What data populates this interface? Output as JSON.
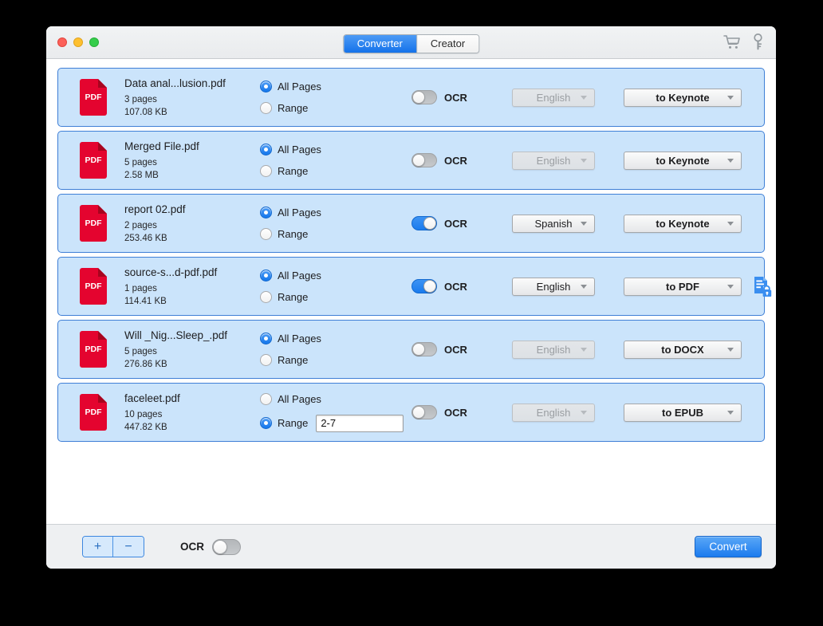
{
  "window": {
    "traffic_lights": [
      "close",
      "minimize",
      "zoom"
    ],
    "tabs": [
      {
        "label": "Converter",
        "active": true
      },
      {
        "label": "Creator",
        "active": false
      }
    ],
    "toolbar_icons": [
      {
        "name": "cart-icon",
        "glyph": "cart"
      },
      {
        "name": "key-icon",
        "glyph": "key"
      }
    ]
  },
  "labels": {
    "all_pages": "All Pages",
    "range": "Range",
    "ocr": "OCR",
    "pdf_badge": "PDF",
    "add": "+",
    "remove": "−"
  },
  "colors": {
    "accent": "#1c7bee",
    "row_background": "#cbe4fb",
    "row_border": "#3f7fd6",
    "pdf_icon": "#e4042f",
    "lock_icon": "#3a8ef0",
    "toolbar_background": "#eef0f2"
  },
  "files": [
    {
      "name": "Data anal...lusion.pdf",
      "pages": "3 pages",
      "size": "107.08 KB",
      "all_pages_selected": true,
      "range_selected": false,
      "range_value": "",
      "ocr_on": false,
      "language": "English",
      "output_format": "to Keynote",
      "locked": false
    },
    {
      "name": "Merged File.pdf",
      "pages": "5 pages",
      "size": "2.58 MB",
      "all_pages_selected": true,
      "range_selected": false,
      "range_value": "",
      "ocr_on": false,
      "language": "English",
      "output_format": "to Keynote",
      "locked": false
    },
    {
      "name": "report 02.pdf",
      "pages": "2 pages",
      "size": "253.46 KB",
      "all_pages_selected": true,
      "range_selected": false,
      "range_value": "",
      "ocr_on": true,
      "language": "Spanish",
      "output_format": "to Keynote",
      "locked": false
    },
    {
      "name": "source-s...d-pdf.pdf",
      "pages": "1 pages",
      "size": "114.41 KB",
      "all_pages_selected": true,
      "range_selected": false,
      "range_value": "",
      "ocr_on": true,
      "language": "English",
      "output_format": "to PDF",
      "locked": true
    },
    {
      "name": "Will _Nig...Sleep_.pdf",
      "pages": "5 pages",
      "size": "276.86 KB",
      "all_pages_selected": true,
      "range_selected": false,
      "range_value": "",
      "ocr_on": false,
      "language": "English",
      "output_format": "to DOCX",
      "locked": false
    },
    {
      "name": "faceleet.pdf",
      "pages": "10 pages",
      "size": "447.82 KB",
      "all_pages_selected": false,
      "range_selected": true,
      "range_value": "2-7",
      "ocr_on": false,
      "language": "English",
      "output_format": "to EPUB",
      "locked": false
    }
  ],
  "bottom_bar": {
    "add_label": "+",
    "remove_label": "−",
    "ocr_label": "OCR",
    "ocr_on": false,
    "convert_label": "Convert"
  }
}
